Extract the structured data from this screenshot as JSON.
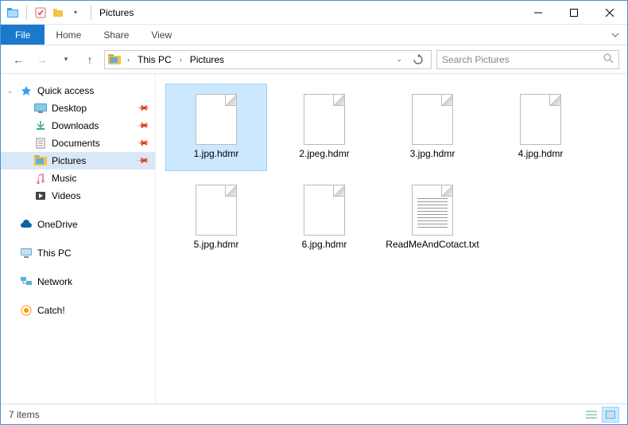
{
  "window": {
    "title": "Pictures"
  },
  "ribbon": {
    "file": "File",
    "tabs": [
      "Home",
      "Share",
      "View"
    ]
  },
  "breadcrumb": {
    "items": [
      "This PC",
      "Pictures"
    ]
  },
  "search": {
    "placeholder": "Search Pictures"
  },
  "sidebar": {
    "quick_access": {
      "label": "Quick access",
      "items": [
        {
          "label": "Desktop",
          "pinned": true
        },
        {
          "label": "Downloads",
          "pinned": true
        },
        {
          "label": "Documents",
          "pinned": true
        },
        {
          "label": "Pictures",
          "pinned": true,
          "selected": true
        },
        {
          "label": "Music",
          "pinned": false
        },
        {
          "label": "Videos",
          "pinned": false
        }
      ]
    },
    "onedrive": {
      "label": "OneDrive"
    },
    "thispc": {
      "label": "This PC"
    },
    "network": {
      "label": "Network"
    },
    "catch": {
      "label": "Catch!"
    }
  },
  "files": [
    {
      "name": "1.jpg.hdmr",
      "type": "blank",
      "selected": true
    },
    {
      "name": "2.jpeg.hdmr",
      "type": "blank"
    },
    {
      "name": "3.jpg.hdmr",
      "type": "blank"
    },
    {
      "name": "4.jpg.hdmr",
      "type": "blank"
    },
    {
      "name": "5.jpg.hdmr",
      "type": "blank"
    },
    {
      "name": "6.jpg.hdmr",
      "type": "blank"
    },
    {
      "name": "ReadMeAndCotact.txt",
      "type": "text"
    }
  ],
  "statusbar": {
    "count_label": "7 items"
  }
}
